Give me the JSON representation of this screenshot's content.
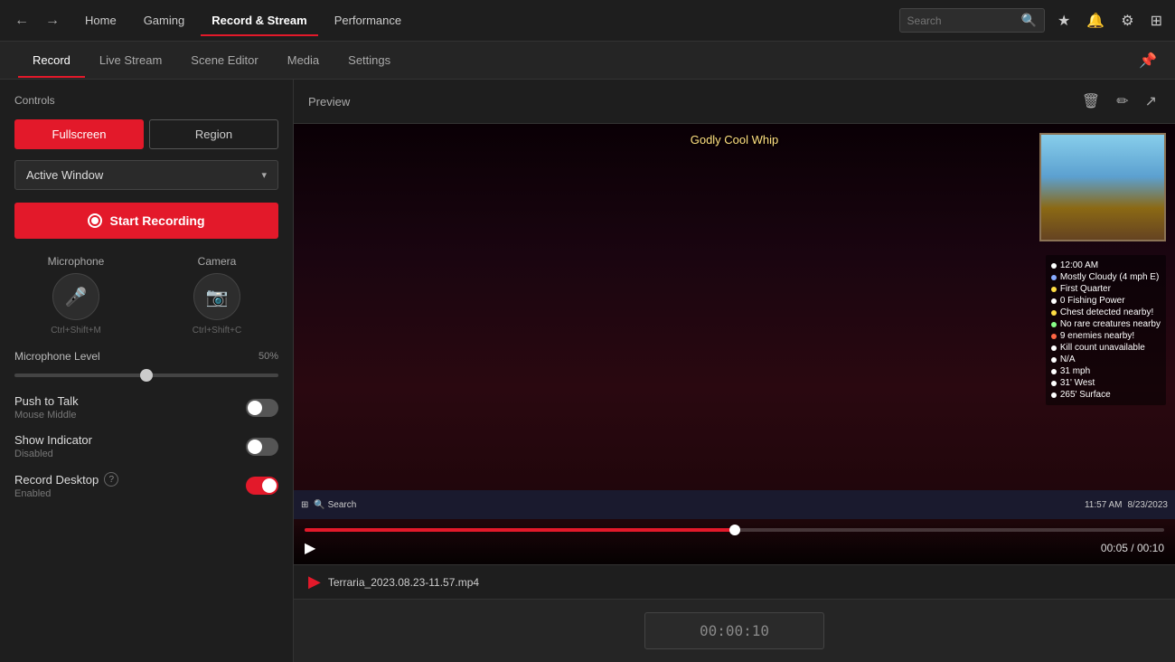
{
  "topNav": {
    "back_label": "←",
    "forward_label": "→",
    "links": [
      "Home",
      "Gaming",
      "Record & Stream",
      "Performance"
    ],
    "active_link": "Record & Stream",
    "search_placeholder": "Search",
    "icons": {
      "bookmark": "★",
      "bell": "🔔",
      "gear": "⚙",
      "grid": "⊞",
      "search": "🔍"
    }
  },
  "subTabs": {
    "tabs": [
      "Record",
      "Live Stream",
      "Scene Editor",
      "Media",
      "Settings"
    ],
    "active_tab": "Record",
    "pin_icon": "📌"
  },
  "leftPanel": {
    "controls_title": "Controls",
    "mode_buttons": [
      {
        "label": "Fullscreen",
        "active": true
      },
      {
        "label": "Region",
        "active": false
      }
    ],
    "dropdown": {
      "value": "Active Window",
      "arrow": "▾"
    },
    "record_btn_label": "Start Recording",
    "microphone": {
      "label": "Microphone",
      "shortcut": "Ctrl+Shift+M",
      "icon": "🎤"
    },
    "camera": {
      "label": "Camera",
      "shortcut": "Ctrl+Shift+C",
      "icon": "📷"
    },
    "microphone_level": {
      "label": "Microphone Level",
      "value": "50%"
    },
    "push_to_talk": {
      "label": "Push to Talk",
      "sub": "Mouse Middle",
      "state": "off"
    },
    "show_indicator": {
      "label": "Show Indicator",
      "sub": "Disabled",
      "state": "off"
    },
    "record_desktop": {
      "label": "Record Desktop",
      "sub": "Enabled",
      "state": "on"
    }
  },
  "rightPanel": {
    "preview_title": "Preview",
    "icons": {
      "trash": "🗑",
      "edit": "✏",
      "export": "↗"
    },
    "hud_lines": [
      {
        "color": "white",
        "text": "12:00 AM"
      },
      {
        "color": "blue",
        "text": "Mostly Cloudy (4 mph E)"
      },
      {
        "color": "yellow",
        "text": "First Quarter"
      },
      {
        "color": "white",
        "text": "0 Fishing Power"
      },
      {
        "color": "yellow",
        "text": "Chest detected nearby!"
      },
      {
        "color": "green",
        "text": "No rare creatures nearby"
      },
      {
        "color": "red",
        "text": "9 enemies nearby!"
      },
      {
        "color": "white",
        "text": "Kill count unavailable"
      },
      {
        "color": "white",
        "text": "N/A"
      },
      {
        "color": "white",
        "text": "31 mph"
      },
      {
        "color": "white",
        "text": "31' West"
      },
      {
        "color": "white",
        "text": "265' Surface"
      }
    ],
    "game_title": "Godly Cool Whip",
    "video_time_current": "00:05",
    "video_time_total": "00:10",
    "progress_percent": 50,
    "file_name": "Terraria_2023.08.23-11.57.mp4",
    "duration": "00:00:10"
  }
}
